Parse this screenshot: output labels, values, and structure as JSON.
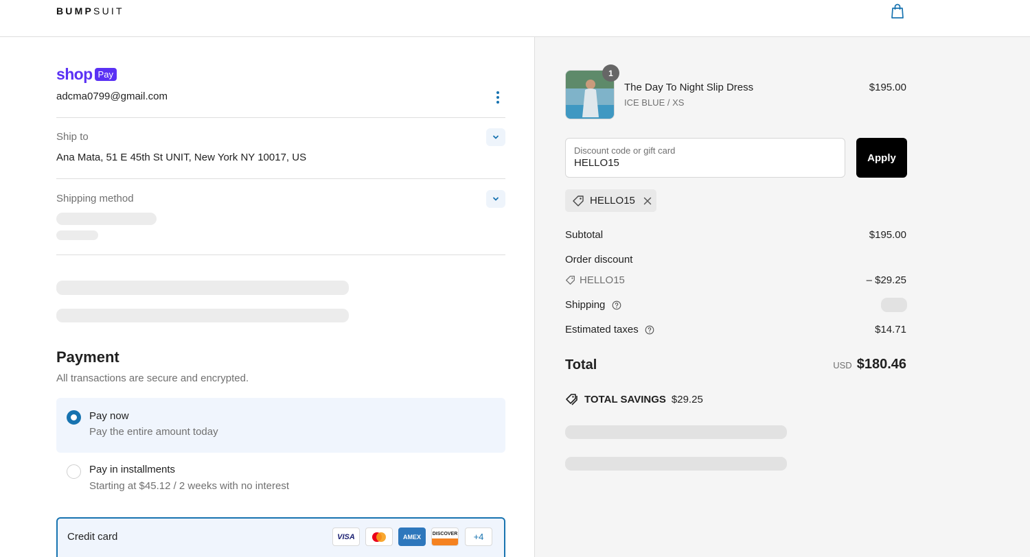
{
  "header": {
    "logo_bold": "BUMP",
    "logo_light": "SUIT",
    "cart_icon": "shopping-bag-icon"
  },
  "account": {
    "brand_word": "shop",
    "brand_badge": "Pay",
    "email": "adcma0799@gmail.com"
  },
  "ship_to": {
    "label": "Ship to",
    "address": "Ana Mata, 51 E 45th St UNIT, New York NY 10017, US"
  },
  "shipping_method": {
    "label": "Shipping method"
  },
  "payment": {
    "title": "Payment",
    "subtitle": "All transactions are secure and encrypted.",
    "options": [
      {
        "title": "Pay now",
        "description": "Pay the entire amount today",
        "selected": true
      },
      {
        "title": "Pay in installments",
        "description": "Starting at $45.12 / 2 weeks with no interest",
        "selected": false
      }
    ],
    "credit_card": {
      "label": "Credit card",
      "brands": [
        "VISA",
        "Mastercard",
        "AMEX",
        "DISCOVER",
        "+4"
      ]
    }
  },
  "order": {
    "item": {
      "quantity": "1",
      "name": "The Day To Night Slip Dress",
      "variant": "ICE BLUE / XS",
      "price": "$195.00"
    },
    "discount": {
      "placeholder": "Discount code or gift card",
      "value": "HELLO15",
      "apply_label": "Apply",
      "applied_code": "HELLO15"
    },
    "summary": {
      "subtotal_label": "Subtotal",
      "subtotal_value": "$195.00",
      "order_discount_label": "Order discount",
      "discount_code": "HELLO15",
      "discount_value": "– $29.25",
      "shipping_label": "Shipping",
      "taxes_label": "Estimated taxes",
      "taxes_value": "$14.71",
      "total_label": "Total",
      "currency": "USD",
      "total_value": "$180.46",
      "savings_label": "TOTAL SAVINGS",
      "savings_value": "$29.25"
    }
  },
  "colors": {
    "accent": "#1773b0",
    "shop_pay": "#5a31f4",
    "selected_bg": "#f0f5fd",
    "summary_bg": "#f5f5f5"
  }
}
